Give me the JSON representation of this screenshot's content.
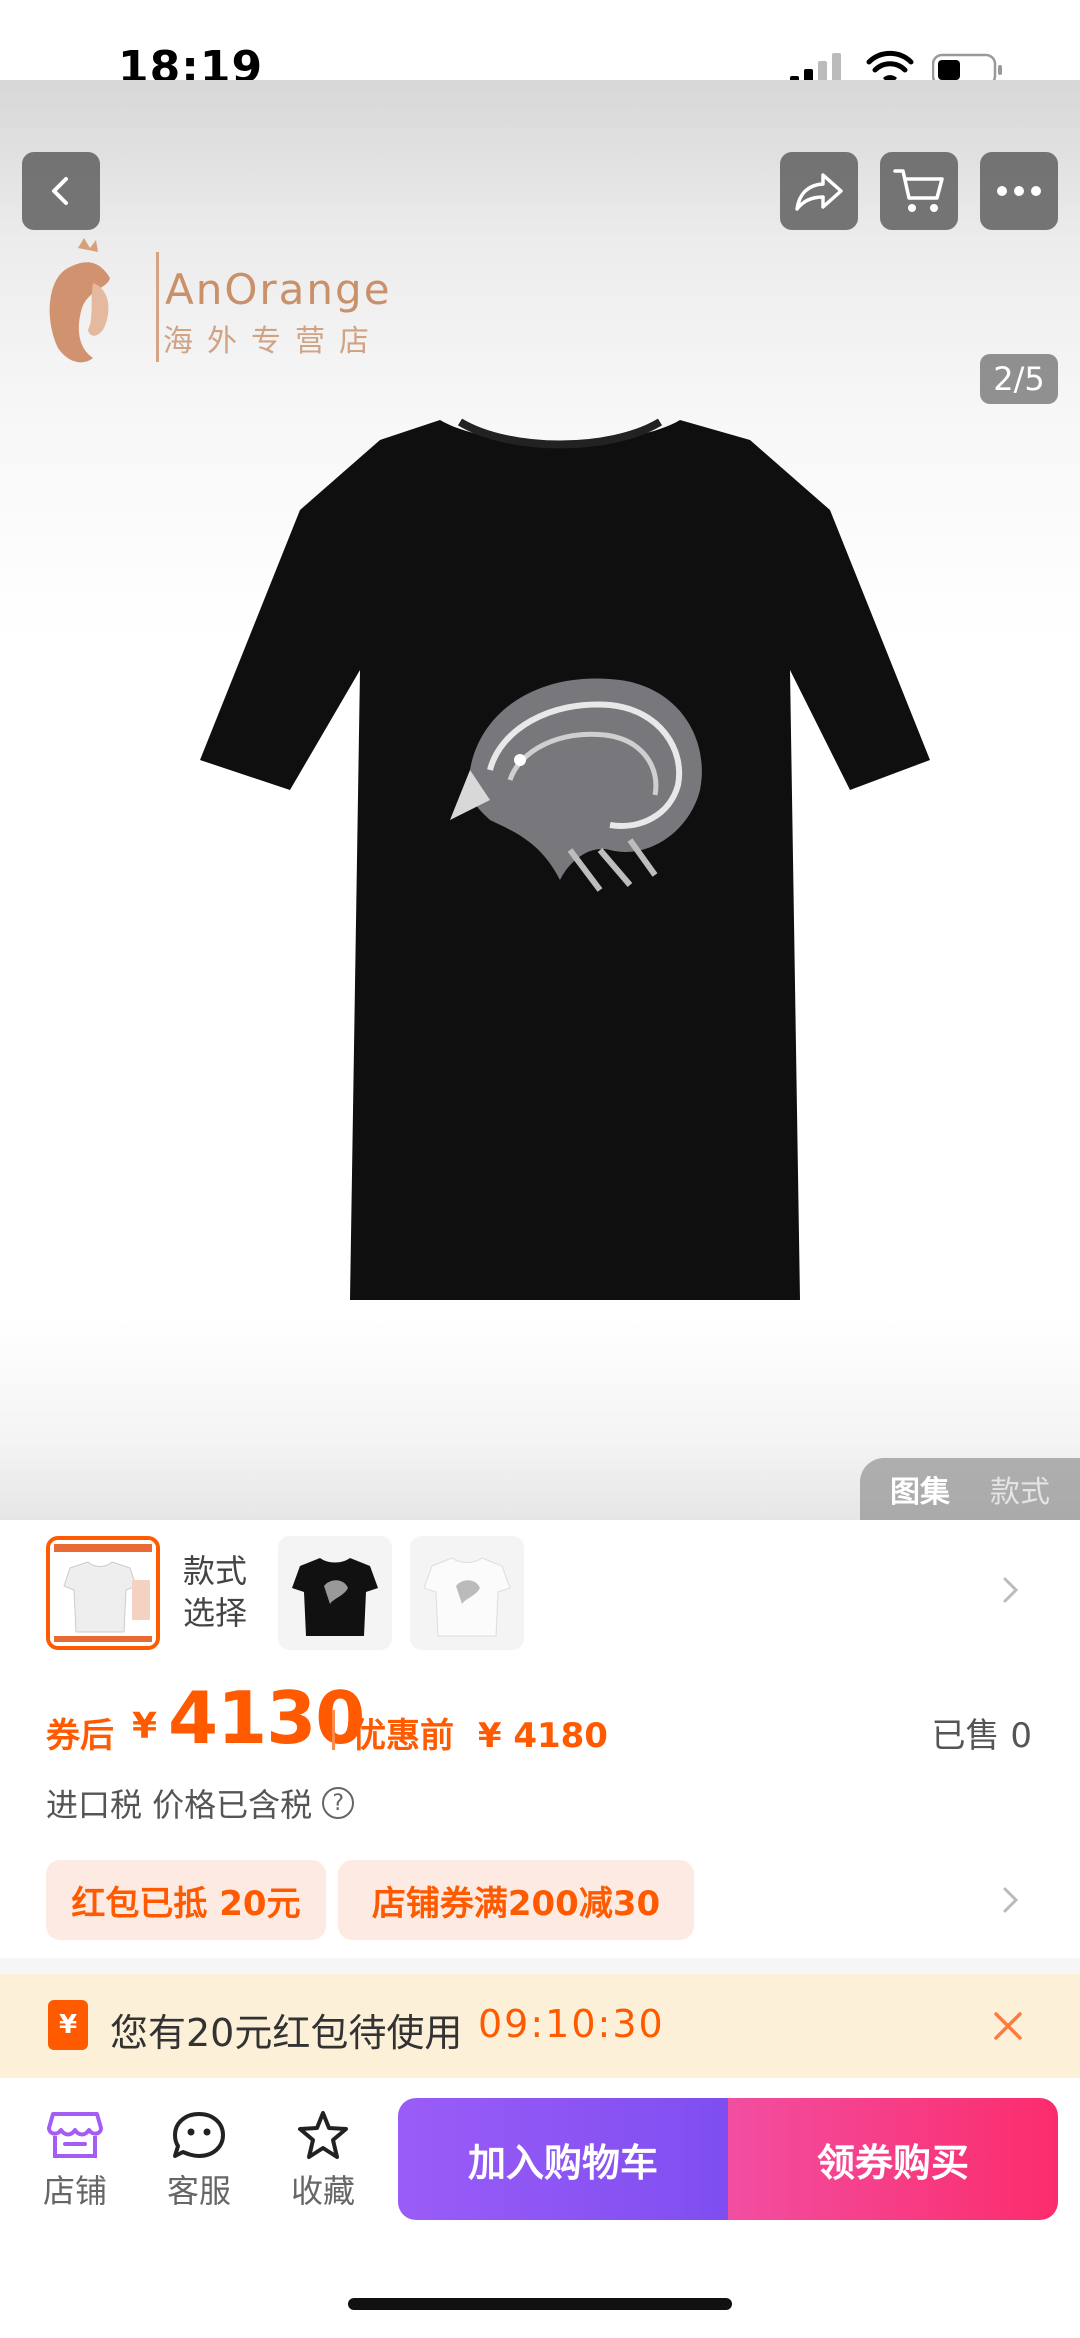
{
  "status_bar": {
    "time": "18:19"
  },
  "hero": {
    "page_indicator": "2/5",
    "store_logo": {
      "name": "AnOrange",
      "subtitle": "海外专营店"
    },
    "gallery_tabs": {
      "active": "图集",
      "inactive": "款式"
    }
  },
  "style_selector": {
    "label": "款式\n选择",
    "label_line1": "款式",
    "label_line2": "选择",
    "thumbnail_count": 3,
    "selected_index": 0
  },
  "price": {
    "after_coupon_label": "券后",
    "currency": "¥",
    "after_coupon_price": "4130",
    "before_discount_label": "优惠前",
    "before_discount_price": "¥ 4180",
    "sold": "已售 0"
  },
  "tax": {
    "text": "进口税 价格已含税",
    "help": "?"
  },
  "coupons": [
    "红包已抵 20元",
    "店铺券满200减30"
  ],
  "banner": {
    "icon": "¥",
    "text": "您有20元红包待使用",
    "timer": "09:10:30"
  },
  "bottom_nav": [
    {
      "label": "店铺",
      "icon": "store-icon"
    },
    {
      "label": "客服",
      "icon": "customer-service-icon"
    },
    {
      "label": "收藏",
      "icon": "star-icon"
    }
  ],
  "actions": {
    "add_to_cart": "加入购物车",
    "buy": "领券购买"
  },
  "colors": {
    "accent": "#ff5a00",
    "cart_button": "#8b55f3",
    "buy_button": "#f83a84",
    "banner_bg": "#fdf0d8"
  }
}
